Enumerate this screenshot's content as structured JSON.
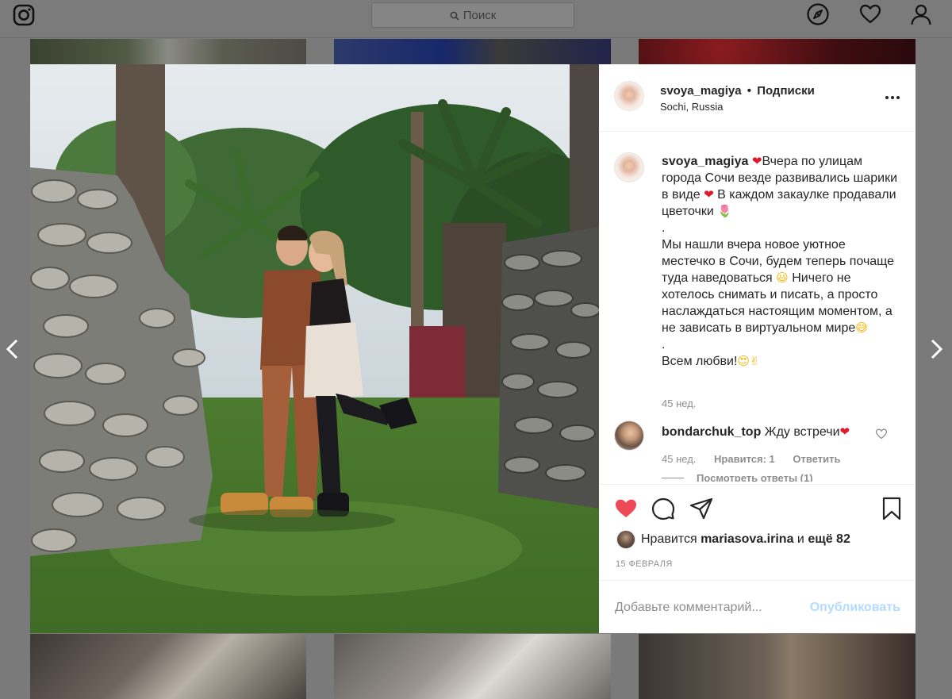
{
  "topbar": {
    "logo_icon": "instagram-camera-icon",
    "search_placeholder": "Поиск",
    "icons": [
      "compass-icon",
      "heart-outline-icon",
      "profile-icon"
    ]
  },
  "nav": {
    "prev_icon": "chevron-left-icon",
    "next_icon": "chevron-right-icon"
  },
  "post": {
    "username": "svoya_magiya",
    "follow_separator": "•",
    "follow_label": "Подписки",
    "location": "Sochi, Russia",
    "more_icon": "more-horizontal-icon",
    "caption": {
      "username": "svoya_magiya",
      "p1": "Вчера по улицам города Сочи везде развивались шарики в виде",
      "p2": "В каждом закаулке продавали цветочки",
      "dot1": ".",
      "p3": "Мы нашли вчера новое уютное местечко в Сочи, будем теперь почаще туда наведоваться",
      "p4": "Ничего не хотелось снимать и писать, а просто наслаждаться настоящим моментом, а не зависать в виртуальном мире",
      "dot2": ".",
      "p5": "Всем любви!",
      "emoji_heart": "❤",
      "emoji_tulip": "🌷",
      "emoji_smile": "😃",
      "emoji_grin": "😅",
      "emoji_love": "😍✌",
      "time": "45 нед."
    },
    "comment": {
      "username": "bondarchuk_top",
      "text": "Жду встречи",
      "emoji": "❤",
      "time": "45 нед.",
      "likes_label": "Нравится: 1",
      "reply_label": "Ответить",
      "view_replies": "Посмотреть ответы (1)"
    },
    "likes": {
      "prefix": "Нравится",
      "user": "mariasova.irina",
      "middle": "и",
      "rest": "ещё 82"
    },
    "date": "15 ФЕВРАЛЯ",
    "add_comment_placeholder": "Добавьте комментарий...",
    "publish_label": "Опубликовать",
    "colors": {
      "like_red": "#ed4956",
      "publish_disabled": "#b3dbff",
      "muted": "#8e8e8e"
    }
  }
}
